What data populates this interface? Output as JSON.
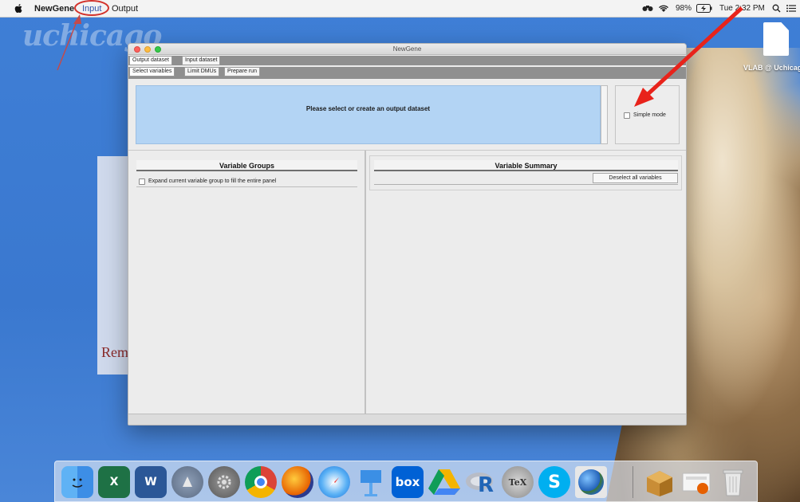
{
  "menubar": {
    "app_name": "NewGene",
    "items": [
      "Input",
      "Output"
    ],
    "battery": "98%",
    "clock": "Tue 2:32 PM"
  },
  "desktop": {
    "logo_text": "uchicago",
    "paper_text": "Rem",
    "file_label": "VLAB @ Uchicago"
  },
  "window": {
    "title": "NewGene",
    "top_tabs": [
      "Output dataset",
      "Input dataset"
    ],
    "sub_tabs": [
      "Select variables",
      "Limit DMUs",
      "Prepare run"
    ],
    "message": "Please select or create an output dataset",
    "simple_mode_label": "Simple mode",
    "simple_mode_checked": false,
    "left_panel": {
      "title": "Variable Groups",
      "expand_label": "Expand current variable group to fill the entire panel",
      "expand_checked": false
    },
    "right_panel": {
      "title": "Variable Summary",
      "deselect_label": "Deselect all variables"
    }
  },
  "dock": {
    "apps": [
      "finder-icon",
      "excel-icon",
      "word-icon",
      "launchpad-icon",
      "system-preferences-icon",
      "chrome-icon",
      "firefox-icon",
      "safari-icon",
      "keynote-icon",
      "box-icon",
      "google-drive-icon",
      "r-icon",
      "tex-icon",
      "skype-icon",
      "globe-icon",
      "installer-icon",
      "preview-icon",
      "trash-icon"
    ],
    "box_label": "box",
    "tex_label": "TeX",
    "skype_label": "S"
  },
  "colors": {
    "desktop_blue": "#3f7fd6",
    "message_blue": "#b3d4f4",
    "annotation_red": "#e8231b"
  }
}
